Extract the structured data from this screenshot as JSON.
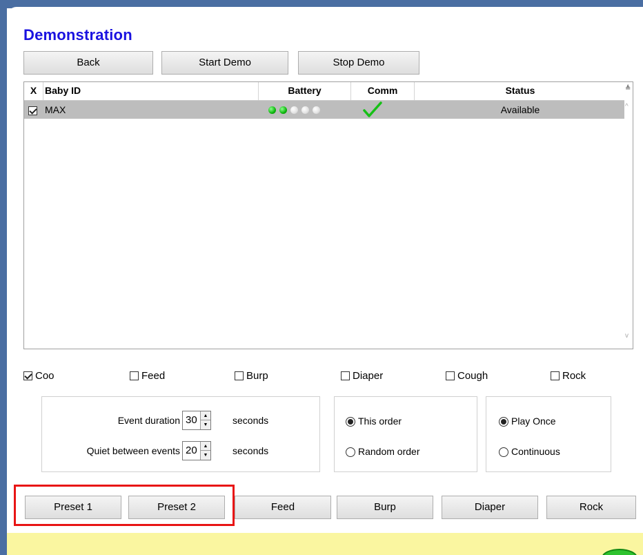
{
  "page": {
    "title": "Demonstration"
  },
  "toolbar": {
    "back": "Back",
    "start_demo": "Start Demo",
    "stop_demo": "Stop Demo"
  },
  "grid": {
    "columns": {
      "select": "X",
      "baby_id": "Baby ID",
      "battery": "Battery",
      "comm": "Comm",
      "status": "Status"
    },
    "rows": [
      {
        "checked": true,
        "baby_id": "MAX",
        "battery_level": 2,
        "battery_max": 5,
        "comm_icon": "green-checkmark-icon",
        "status": "Available"
      }
    ]
  },
  "events": {
    "coo": {
      "label": "Coo",
      "checked": true
    },
    "feed": {
      "label": "Feed",
      "checked": false
    },
    "burp": {
      "label": "Burp",
      "checked": false
    },
    "diaper": {
      "label": "Diaper",
      "checked": false
    },
    "cough": {
      "label": "Cough",
      "checked": false
    },
    "rock": {
      "label": "Rock",
      "checked": false
    }
  },
  "timing": {
    "event_duration_label": "Event duration",
    "event_duration_value": "30",
    "quiet_label": "Quiet between events",
    "quiet_value": "20",
    "unit": "seconds"
  },
  "order": {
    "this_order": "This order",
    "random_order": "Random order",
    "selected": "this_order"
  },
  "playback": {
    "play_once": "Play Once",
    "continuous": "Continuous",
    "selected": "play_once"
  },
  "bottom_buttons": {
    "preset1": "Preset 1",
    "preset2": "Preset 2",
    "feed": "Feed",
    "burp": "Burp",
    "diaper": "Diaper",
    "rock": "Rock"
  },
  "colors": {
    "title": "#1a12e0",
    "highlight": "#e81414",
    "battery_on": "#0cb50c",
    "comm_check": "#16c016",
    "status_bar": "#faf6a0",
    "window_frame": "#4a6ea2"
  }
}
